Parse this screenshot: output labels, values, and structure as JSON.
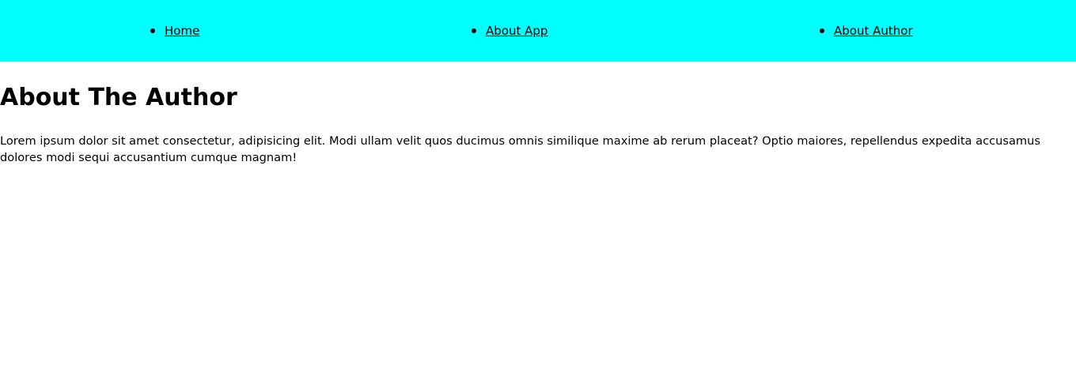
{
  "nav": {
    "items": [
      {
        "label": "Home"
      },
      {
        "label": "About App"
      },
      {
        "label": "About Author"
      }
    ]
  },
  "main": {
    "title": "About The Author",
    "text": "Lorem ipsum dolor sit amet consectetur, adipisicing elit. Modi ullam velit quos ducimus omnis similique maxime ab rerum placeat? Optio maiores, repellendus expedita accusamus dolores modi sequi accusantium cumque magnam!"
  },
  "colors": {
    "nav_background": "#00ffff",
    "text": "#000000",
    "page_background": "#ffffff"
  }
}
